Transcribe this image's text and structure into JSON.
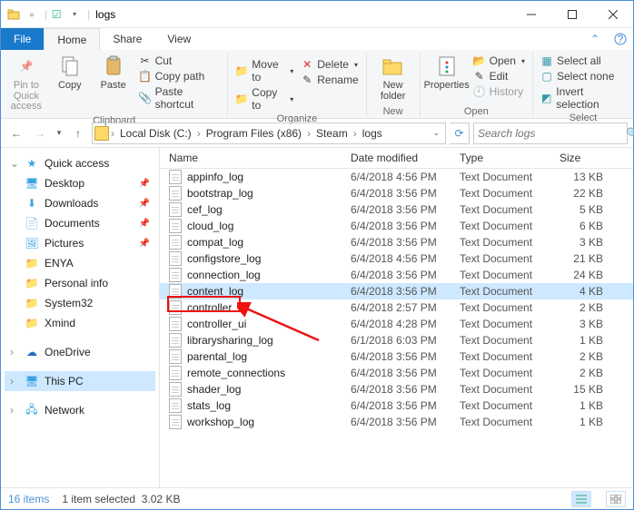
{
  "title": "logs",
  "menutabs": {
    "file": "File",
    "home": "Home",
    "share": "Share",
    "view": "View"
  },
  "ribbon": {
    "clipboard": {
      "label": "Clipboard",
      "pin": "Pin to Quick\naccess",
      "copy": "Copy",
      "paste": "Paste",
      "cut": "Cut",
      "copypath": "Copy path",
      "pasteshort": "Paste shortcut"
    },
    "organize": {
      "label": "Organize",
      "moveto": "Move to",
      "copyto": "Copy to",
      "delete": "Delete",
      "rename": "Rename"
    },
    "new": {
      "label": "New",
      "newfolder": "New\nfolder"
    },
    "open": {
      "label": "Open",
      "properties": "Properties",
      "open": "Open",
      "edit": "Edit",
      "history": "History"
    },
    "select": {
      "label": "Select",
      "all": "Select all",
      "none": "Select none",
      "invert": "Invert selection"
    }
  },
  "breadcrumbs": [
    "Local Disk (C:)",
    "Program Files (x86)",
    "Steam",
    "logs"
  ],
  "search_placeholder": "Search logs",
  "nav": {
    "quick": "Quick access",
    "items": [
      "Desktop",
      "Downloads",
      "Documents",
      "Pictures",
      "ENYA",
      "Personal info",
      "System32",
      "Xmind"
    ],
    "onedrive": "OneDrive",
    "thispc": "This PC",
    "network": "Network"
  },
  "columns": {
    "name": "Name",
    "date": "Date modified",
    "type": "Type",
    "size": "Size"
  },
  "files": [
    {
      "name": "appinfo_log",
      "date": "6/4/2018 4:56 PM",
      "type": "Text Document",
      "size": "13 KB"
    },
    {
      "name": "bootstrap_log",
      "date": "6/4/2018 3:56 PM",
      "type": "Text Document",
      "size": "22 KB"
    },
    {
      "name": "cef_log",
      "date": "6/4/2018 3:56 PM",
      "type": "Text Document",
      "size": "5 KB"
    },
    {
      "name": "cloud_log",
      "date": "6/4/2018 3:56 PM",
      "type": "Text Document",
      "size": "6 KB"
    },
    {
      "name": "compat_log",
      "date": "6/4/2018 3:56 PM",
      "type": "Text Document",
      "size": "3 KB"
    },
    {
      "name": "configstore_log",
      "date": "6/4/2018 4:56 PM",
      "type": "Text Document",
      "size": "21 KB"
    },
    {
      "name": "connection_log",
      "date": "6/4/2018 3:56 PM",
      "type": "Text Document",
      "size": "24 KB"
    },
    {
      "name": "content_log",
      "date": "6/4/2018 3:56 PM",
      "type": "Text Document",
      "size": "4 KB"
    },
    {
      "name": "controller",
      "date": "6/4/2018 2:57 PM",
      "type": "Text Document",
      "size": "2 KB"
    },
    {
      "name": "controller_ui",
      "date": "6/4/2018 4:28 PM",
      "type": "Text Document",
      "size": "3 KB"
    },
    {
      "name": "librarysharing_log",
      "date": "6/1/2018 6:03 PM",
      "type": "Text Document",
      "size": "1 KB"
    },
    {
      "name": "parental_log",
      "date": "6/4/2018 3:56 PM",
      "type": "Text Document",
      "size": "2 KB"
    },
    {
      "name": "remote_connections",
      "date": "6/4/2018 3:56 PM",
      "type": "Text Document",
      "size": "2 KB"
    },
    {
      "name": "shader_log",
      "date": "6/4/2018 3:56 PM",
      "type": "Text Document",
      "size": "15 KB"
    },
    {
      "name": "stats_log",
      "date": "6/4/2018 3:56 PM",
      "type": "Text Document",
      "size": "1 KB"
    },
    {
      "name": "workshop_log",
      "date": "6/4/2018 3:56 PM",
      "type": "Text Document",
      "size": "1 KB"
    }
  ],
  "selected_index": 7,
  "status": {
    "count": "16 items",
    "selected": "1 item selected",
    "size": "3.02 KB"
  }
}
